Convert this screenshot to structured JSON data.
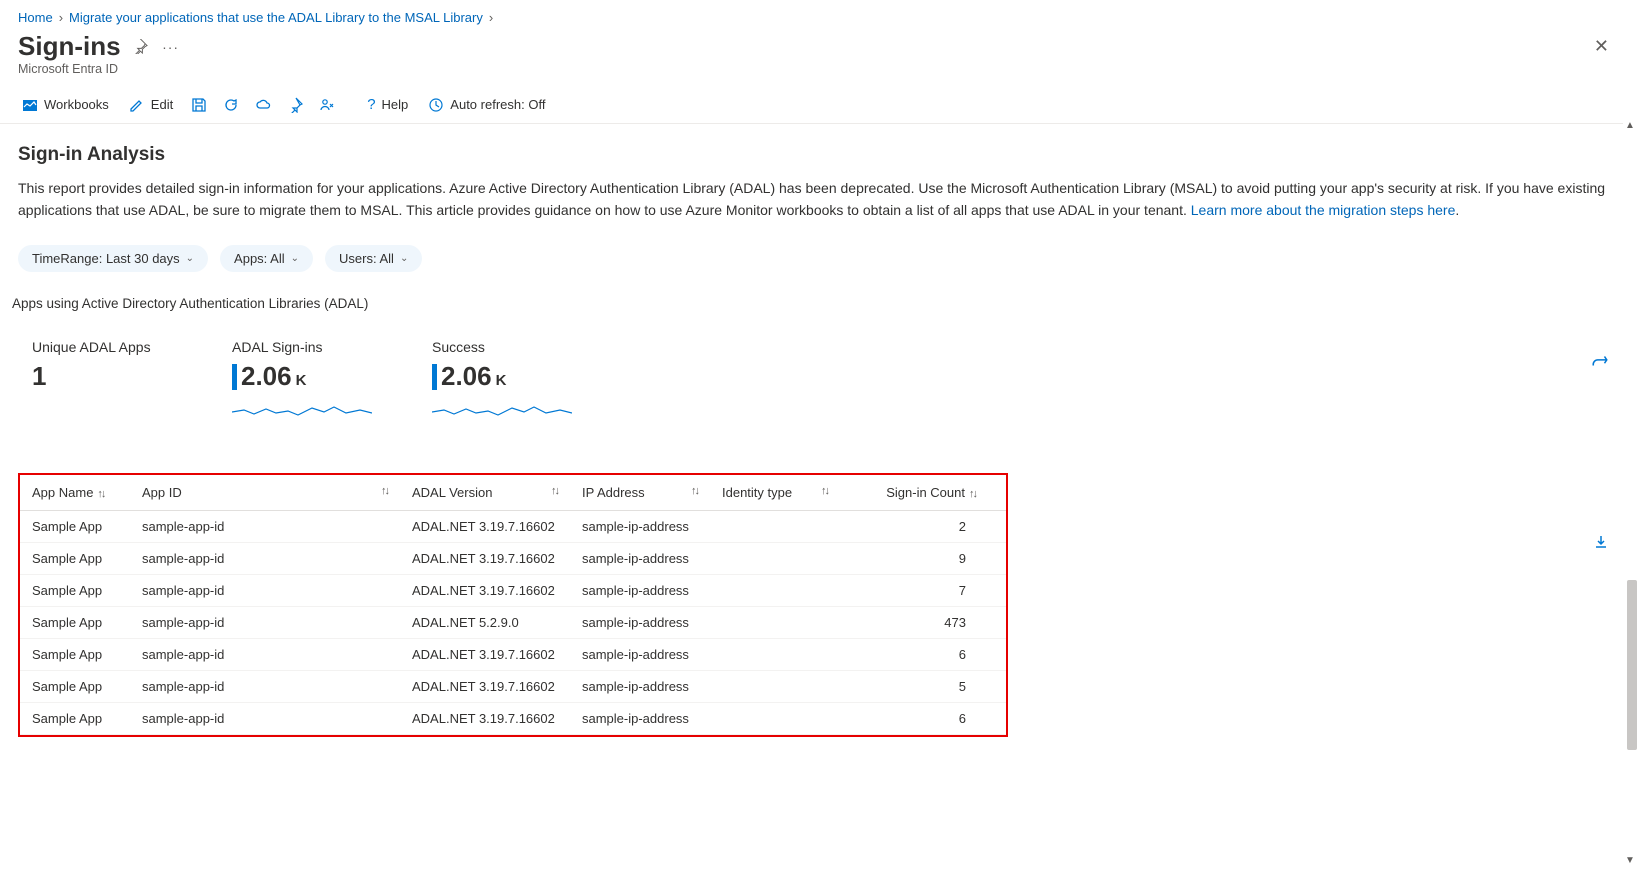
{
  "breadcrumb": {
    "items": [
      "Home",
      "Migrate your applications that use the ADAL Library to the MSAL Library"
    ]
  },
  "header": {
    "title": "Sign-ins",
    "subtitle": "Microsoft Entra ID"
  },
  "toolbar": {
    "workbooks": "Workbooks",
    "edit": "Edit",
    "help": "Help",
    "autorefresh": "Auto refresh: Off"
  },
  "section": {
    "title": "Sign-in Analysis",
    "description_pre": "This report provides detailed sign-in information for your applications. Azure Active Directory Authentication Library (ADAL) has been deprecated. Use the Microsoft Authentication Library (MSAL) to avoid putting your app's security at risk. If you have existing applications that use ADAL, be sure to migrate them to MSAL. This article provides guidance on how to use Azure Monitor workbooks to obtain a list of all apps that use ADAL in your tenant. ",
    "description_link": "Learn more about the migration steps here",
    "description_post": "."
  },
  "filters": {
    "timerange": "TimeRange: Last 30 days",
    "apps": "Apps: All",
    "users": "Users: All"
  },
  "subheading": "Apps using Active Directory Authentication Libraries (ADAL)",
  "metrics": {
    "unique": {
      "label": "Unique ADAL Apps",
      "value": "1"
    },
    "signins": {
      "label": "ADAL Sign-ins",
      "value": "2.06",
      "suffix": "K"
    },
    "success": {
      "label": "Success",
      "value": "2.06",
      "suffix": "K"
    }
  },
  "table": {
    "headers": {
      "app_name": "App Name",
      "app_id": "App ID",
      "adal_version": "ADAL Version",
      "ip_address": "IP Address",
      "identity_type": "Identity type",
      "signin_count": "Sign-in Count"
    },
    "rows": [
      {
        "app_name": "Sample App",
        "app_id": "sample-app-id",
        "adal_version": "ADAL.NET 3.19.7.16602",
        "ip_address": "sample-ip-address",
        "identity_type": "",
        "signin_count": "2"
      },
      {
        "app_name": "Sample App",
        "app_id": "sample-app-id",
        "adal_version": "ADAL.NET 3.19.7.16602",
        "ip_address": "sample-ip-address",
        "identity_type": "",
        "signin_count": "9"
      },
      {
        "app_name": "Sample App",
        "app_id": "sample-app-id",
        "adal_version": "ADAL.NET 3.19.7.16602",
        "ip_address": "sample-ip-address",
        "identity_type": "",
        "signin_count": "7"
      },
      {
        "app_name": "Sample App",
        "app_id": "sample-app-id",
        "adal_version": "ADAL.NET 5.2.9.0",
        "ip_address": "sample-ip-address",
        "identity_type": "",
        "signin_count": "473"
      },
      {
        "app_name": "Sample App",
        "app_id": "sample-app-id",
        "adal_version": "ADAL.NET 3.19.7.16602",
        "ip_address": "sample-ip-address",
        "identity_type": "",
        "signin_count": "6"
      },
      {
        "app_name": "Sample App",
        "app_id": "sample-app-id",
        "adal_version": "ADAL.NET 3.19.7.16602",
        "ip_address": "sample-ip-address",
        "identity_type": "",
        "signin_count": "5"
      },
      {
        "app_name": "Sample App",
        "app_id": "sample-app-id",
        "adal_version": "ADAL.NET 3.19.7.16602",
        "ip_address": "sample-ip-address",
        "identity_type": "",
        "signin_count": "6"
      }
    ]
  }
}
